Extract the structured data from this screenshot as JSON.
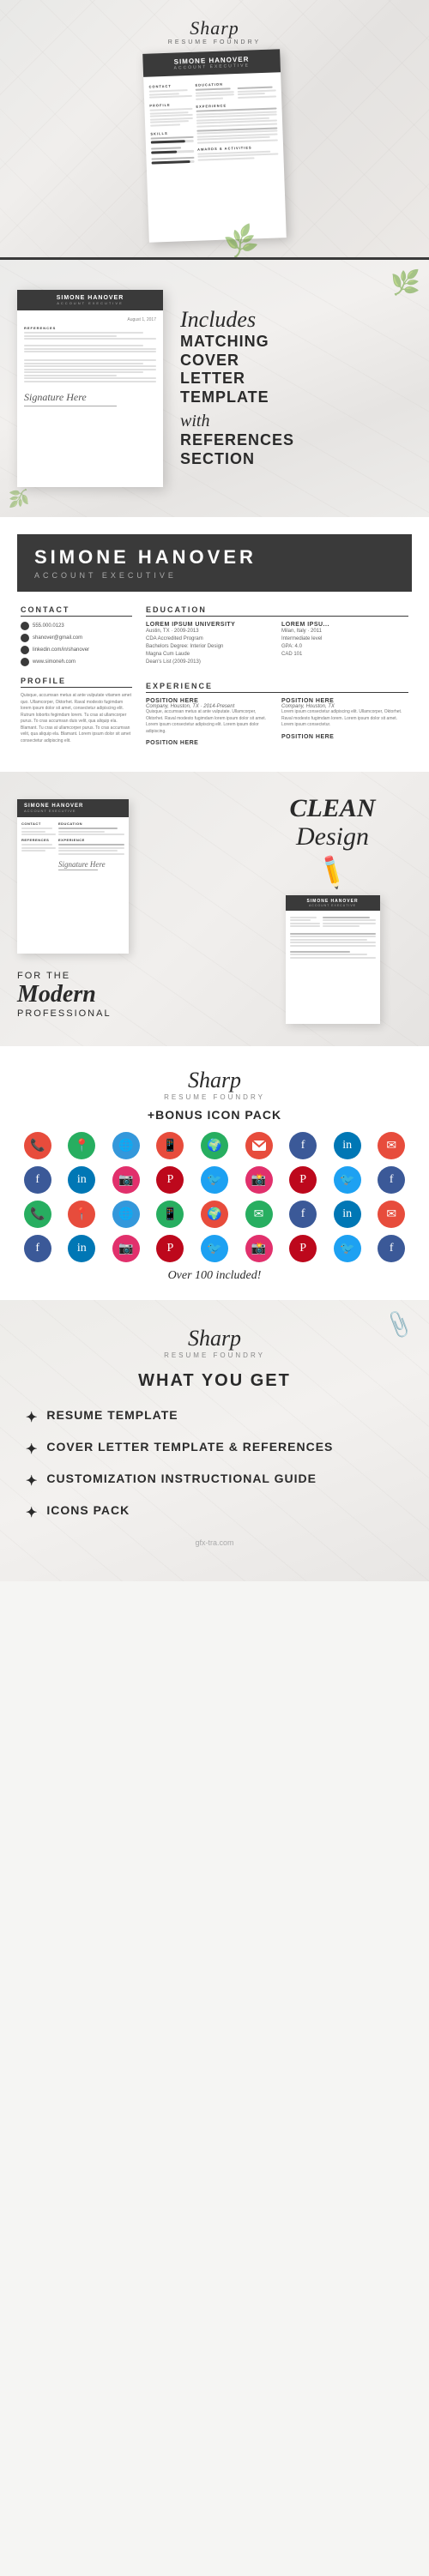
{
  "brand": {
    "name": "Sharp",
    "sub": "Resume Foundry"
  },
  "person": {
    "name": "SIMONE HANOVER",
    "title": "ACCOUNT EXECUTIVE"
  },
  "section1": {
    "label": "hero-resume-preview"
  },
  "section2": {
    "includes": "Includes",
    "line1": "MATCHING",
    "line2": "COVER",
    "line3": "LETTER",
    "line4": "TEMPLATE",
    "with": "with",
    "line5": "REFERENCES",
    "line6": "SECTION"
  },
  "resume": {
    "contact_label": "CONTACT",
    "education_label": "EDUCATION",
    "profile_label": "PROFILE",
    "experience_label": "EXPERIENCE",
    "skills_label": "SKILLS",
    "awards_label": "AWARDS & ACTIVITIES",
    "references_label": "REFERENCES",
    "phone": "555.000.0123",
    "email": "shanover@gmail.com",
    "linkedin": "linkedin.com/in/shanover",
    "website": "www.simoneh.com",
    "edu1_school": "LOREM IPSUM UNIVERSITY",
    "edu1_location": "Austin, TX · 2009-2013",
    "edu1_degree": "CDA Accredited Program",
    "edu1_major": "Bachelors Degree: Interior Design",
    "edu1_honors": "Magna Cum Laude",
    "edu1_dates": "Dean's List (2009-2013)",
    "edu2_school": "LOREM IPSU...",
    "edu2_location": "Milan, Italy · 2011",
    "edu2_detail": "Intermediate level",
    "edu2_gpa": "GPA: 4.0",
    "edu2_cad": "CAD 101",
    "profile_text": "Quisque, accumsan metus at ante vulputate vitamen amet quo. Ullamcorper, Oktorhet. Raval modesto fugimdam lorem ipsum dolor sit amet, consectetur adipiscing elit. Rutrum lobortis fegimdam lorem. Tu cras at ullamcorper purus. To cras accumsan duis velit, qua aliquip ela. Blamant. Tu cras at ullamcorper purus. To cras accumsan velit, qua aliquip ela. Blamant. Lorem ipsum dolor sit amet consectetur adipiscing elit.",
    "exp1_title": "POSITION HERE",
    "exp1_company": "Company, Houston, TX · 2014-Present",
    "exp2_title": "POSITION HERE",
    "exp2_company": "Company, Houston, TX",
    "exp3_title": "POSITION HERE"
  },
  "section4": {
    "clean": "CLEAN",
    "design": "Design",
    "for_the": "FOR THE",
    "modern": "Modern",
    "professional": "PROFESSIONAL"
  },
  "icons": {
    "bonus_label": "+BONUS ICON PACK",
    "over100": "Over 100 included!",
    "colors": [
      "#e74c3c",
      "#27ae60",
      "#3498db",
      "#e74c3c",
      "#27ae60",
      "#e74c3c",
      "#3498db",
      "#27ae60",
      "#3498db"
    ]
  },
  "what_you_get": {
    "title": "WHAT YOU GET",
    "items": [
      "RESUME TEMPLATE",
      "COVER LETTER TEMPLATE & REFERENCES",
      "CUSTOMIZATION INSTRUCTIONAL GUIDE",
      "ICONS PACK"
    ],
    "star": "✦"
  },
  "watermark": "gfx-tra.com"
}
